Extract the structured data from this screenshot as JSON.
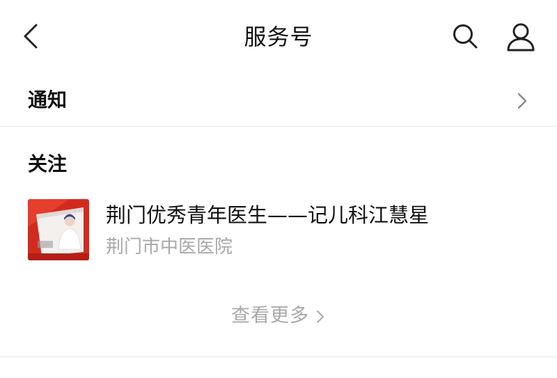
{
  "header": {
    "title": "服务号",
    "back_icon": "chevron-left-icon",
    "search_icon": "search-icon",
    "profile_icon": "person-icon"
  },
  "notice": {
    "label": "通知",
    "chevron_icon": "chevron-right-icon"
  },
  "follow": {
    "section_label": "关注",
    "items": [
      {
        "title": "荆门优秀青年医生——记儿科江慧星",
        "source": "荆门市中医医院",
        "thumbnail": "doctor-photo"
      }
    ],
    "more_label": "查看更多",
    "more_chevron_icon": "chevron-right-icon"
  },
  "colors": {
    "text_primary": "#111111",
    "text_secondary": "#a8a8a8",
    "divider": "#e8e8e8",
    "thumb_red": "#d32a1e"
  }
}
